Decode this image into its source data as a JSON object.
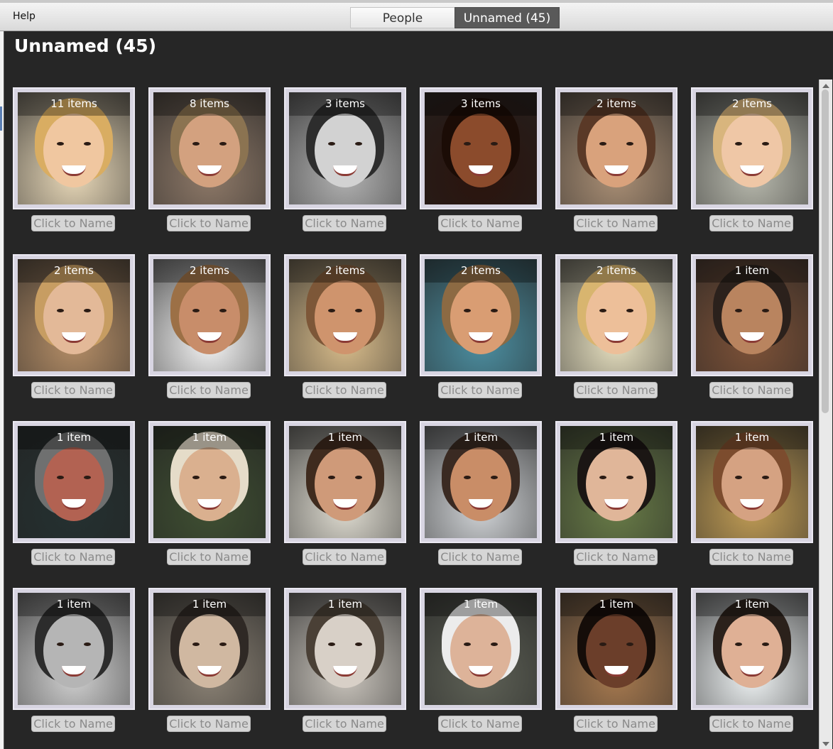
{
  "menu": {
    "help_label": "Help"
  },
  "tabs": [
    {
      "label": "People"
    },
    {
      "label": "Unnamed (45)"
    }
  ],
  "page_title": "Unnamed (45)",
  "card_action_label": "Click to Name",
  "cards": [
    {
      "count": "11 items",
      "bg": "#e8d8b8",
      "skin": "#f0c7a0",
      "hair": "#d9ad62"
    },
    {
      "count": "8 items",
      "bg": "#8e7968",
      "skin": "#d3a17f",
      "hair": "#8b7351"
    },
    {
      "count": "3 items",
      "bg": "#b2b2b2",
      "skin": "#d2d2d2",
      "hair": "#2d2d2d"
    },
    {
      "count": "3 items",
      "bg": "#2b140d",
      "skin": "#8b4b2c",
      "hair": "#1b0c06"
    },
    {
      "count": "2 items",
      "bg": "#aa8f75",
      "skin": "#d9a27c",
      "hair": "#5a3927"
    },
    {
      "count": "2 items",
      "bg": "#b8b9ad",
      "skin": "#efc7a6",
      "hair": "#d8b57d"
    },
    {
      "count": "2 items",
      "bg": "#b58e67",
      "skin": "#e3b998",
      "hair": "#c79d62"
    },
    {
      "count": "2 items",
      "bg": "#f4f4f4",
      "skin": "#c88d6a",
      "hair": "#9c7046"
    },
    {
      "count": "2 items",
      "bg": "#d8bc8b",
      "skin": "#cf946d",
      "hair": "#7d5738"
    },
    {
      "count": "2 items",
      "bg": "#4c8ea0",
      "skin": "#d99d73",
      "hair": "#8c6a43"
    },
    {
      "count": "2 items",
      "bg": "#e7e0c0",
      "skin": "#edbf99",
      "hair": "#d8b56f"
    },
    {
      "count": "1 item",
      "bg": "#7d5238",
      "skin": "#b9845f",
      "hair": "#2b211c"
    },
    {
      "count": "1 item",
      "bg": "#253131",
      "skin": "#b26252",
      "hair": "#6f7070"
    },
    {
      "count": "1 item",
      "bg": "#3f4f32",
      "skin": "#dab08f",
      "hair": "#e5dcc9"
    },
    {
      "count": "1 item",
      "bg": "#dedbd0",
      "skin": "#cf9a79",
      "hair": "#3f2b1e"
    },
    {
      "count": "1 item",
      "bg": "#cfd2d5",
      "skin": "#c98d67",
      "hair": "#3a2a22"
    },
    {
      "count": "1 item",
      "bg": "#687b47",
      "skin": "#e0b699",
      "hair": "#1b1614"
    },
    {
      "count": "1 item",
      "bg": "#c09c55",
      "skin": "#d5a282",
      "hair": "#7c4c2e"
    },
    {
      "count": "1 item",
      "bg": "#d0d0d0",
      "skin": "#b5b5b5",
      "hair": "#2c2c2c"
    },
    {
      "count": "1 item",
      "bg": "#8a8174",
      "skin": "#d0b8a1",
      "hair": "#2f2925"
    },
    {
      "count": "1 item",
      "bg": "#c8c3bb",
      "skin": "#d8d0c7",
      "hair": "#4a4036"
    },
    {
      "count": "1 item",
      "bg": "#5e6156",
      "skin": "#ddb399",
      "hair": "#ececec"
    },
    {
      "count": "1 item",
      "bg": "#a6794f",
      "skin": "#6b3e2a",
      "hair": "#150d09"
    },
    {
      "count": "1 item",
      "bg": "#eef2f3",
      "skin": "#dfb095",
      "hair": "#2b211b"
    }
  ]
}
